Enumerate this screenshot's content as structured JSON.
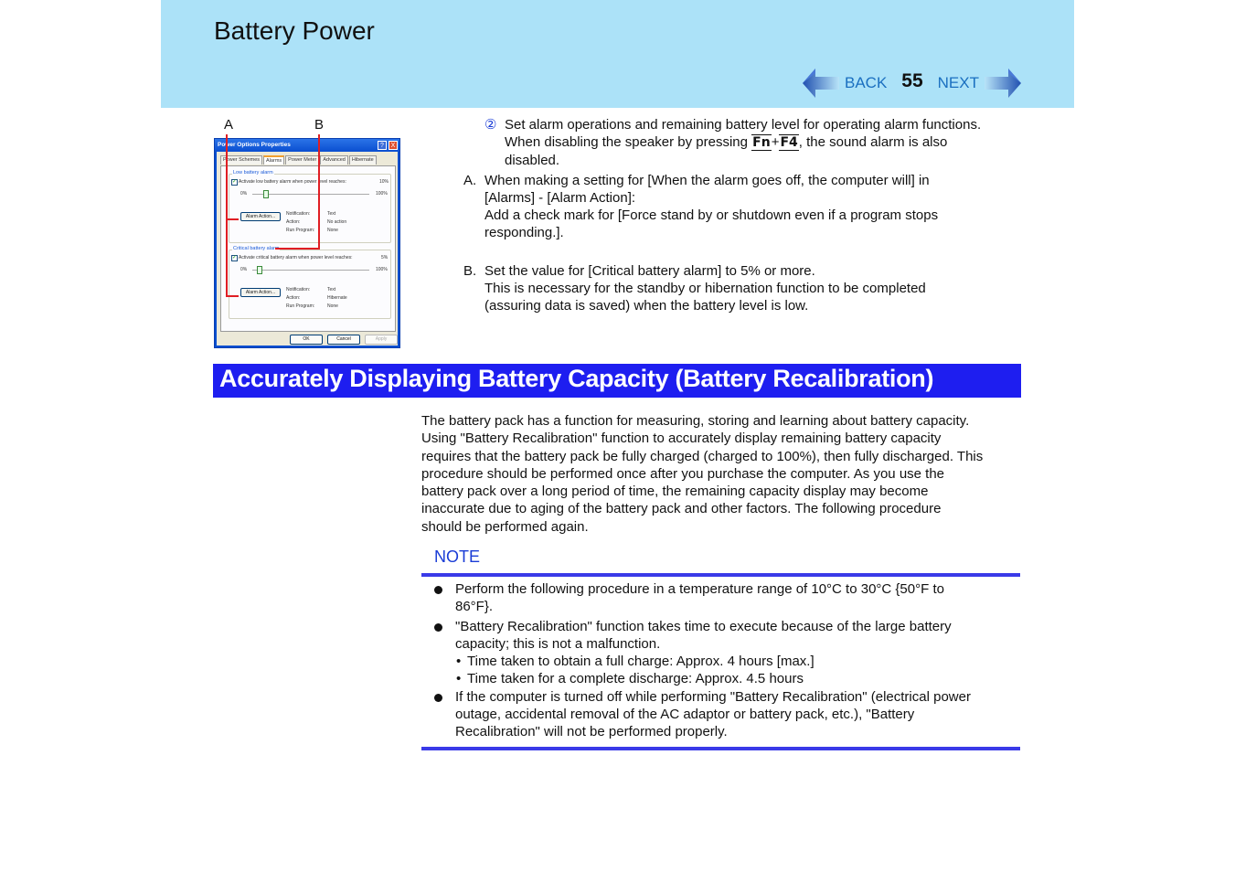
{
  "header": {
    "title": "Battery Power",
    "back_label": "BACK",
    "next_label": "NEXT",
    "page_number": "55",
    "background_color": "#ace2f8"
  },
  "figure": {
    "callout_a": "A",
    "callout_b": "B",
    "dialog": {
      "title": "Power Options Properties",
      "help_button": "?",
      "close_button": "X",
      "tabs": [
        "Power Schemes",
        "Alarms",
        "Power Meter",
        "Advanced",
        "Hibernate"
      ],
      "active_tab": "Alarms",
      "low_battery": {
        "group_title": "Low battery alarm",
        "checkbox_label": "Activate low battery alarm when power level reaches:",
        "checked": true,
        "value": "10%",
        "min_label": "0%",
        "max_label": "100%",
        "slider_level_percent": 10,
        "action_button": "Alarm Action...",
        "notification_label": "Notification:",
        "notification_value": "Text",
        "action_label": "Action:",
        "action_value": "No action",
        "run_program_label": "Run Program:",
        "run_program_value": "None"
      },
      "critical_battery": {
        "group_title": "Critical battery alarm",
        "checkbox_label": "Activate critical battery alarm when power level reaches:",
        "checked": true,
        "value": "5%",
        "min_label": "0%",
        "max_label": "100%",
        "slider_level_percent": 5,
        "action_button": "Alarm Action...",
        "notification_label": "Notification:",
        "notification_value": "Text",
        "action_label": "Action:",
        "action_value": "Hibernate",
        "run_program_label": "Run Program:",
        "run_program_value": "None"
      },
      "ok_button": "OK",
      "cancel_button": "Cancel",
      "apply_button": "Apply"
    }
  },
  "step2": {
    "marker": "②",
    "line1": "Set alarm operations and remaining battery level for operating alarm functions.",
    "line2_before": "When disabling the speaker by pressing ",
    "key1": "Fn",
    "plus": "+",
    "key2": "F4",
    "line2_after": ", the sound alarm is also",
    "line3": "disabled."
  },
  "items": [
    {
      "label": "A.",
      "lines": [
        "When making a setting for [When the alarm goes off, the computer will] in",
        "[Alarms] - [Alarm Action]:",
        "Add a check mark for [Force stand by or shutdown even if a program stops",
        "responding.]."
      ]
    },
    {
      "label": "B.",
      "lines": [
        "Set the value for [Critical battery alarm] to 5% or more.",
        "This is necessary for the standby or hibernation function to be completed",
        "(assuring data is saved) when the battery level is low."
      ]
    }
  ],
  "section": {
    "title": "Accurately Displaying Battery Capacity (Battery Recalibration)",
    "color": "#1e1ef0"
  },
  "paragraph": {
    "lines": [
      "The battery pack has a function for measuring, storing and learning about battery capacity.",
      "Using \"Battery Recalibration\" function to accurately display remaining battery capacity",
      "requires that the battery pack be fully charged (charged to 100%), then fully discharged. This",
      "procedure should be performed once after you purchase the computer.  As you use the",
      "battery pack over a long period of time, the remaining capacity display may become",
      "inaccurate due to aging of the battery pack and other factors.  The following procedure",
      "should be performed again."
    ]
  },
  "note": {
    "title": "NOTE",
    "bullets": [
      {
        "lines": [
          "Perform the following procedure in a temperature range of 10°C to 30°C {50°F to",
          "86°F}."
        ]
      },
      {
        "lines": [
          "\"Battery Recalibration\" function takes time to execute because of the large battery",
          "capacity; this is not a malfunction."
        ],
        "sub": [
          "Time taken to obtain a full charge: Approx. 4 hours [max.]",
          "Time taken for a complete discharge: Approx. 4.5 hours"
        ]
      },
      {
        "lines": [
          "If the computer is turned off while performing \"Battery Recalibration\" (electrical power",
          "outage, accidental removal of the AC adaptor or battery pack, etc.), \"Battery",
          "Recalibration\" will not be performed properly."
        ]
      }
    ]
  }
}
